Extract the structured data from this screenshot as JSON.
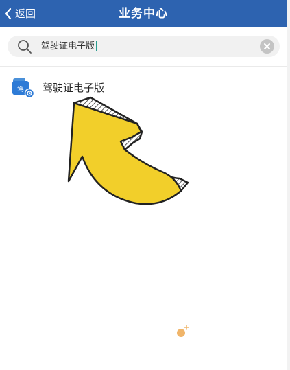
{
  "header": {
    "back_label": "返回",
    "title": "业务中心",
    "bg_color": "#2d63b0"
  },
  "search": {
    "value": "驾驶证电子版",
    "icon": "search-icon",
    "clear_icon": "clear-icon"
  },
  "results": [
    {
      "label": "驾驶证电子版",
      "icon_text": "驾",
      "icon": "drivers-license-icon"
    }
  ],
  "overlay": {
    "icon": "curved-arrow-icon",
    "color": "#f2cf2a"
  }
}
